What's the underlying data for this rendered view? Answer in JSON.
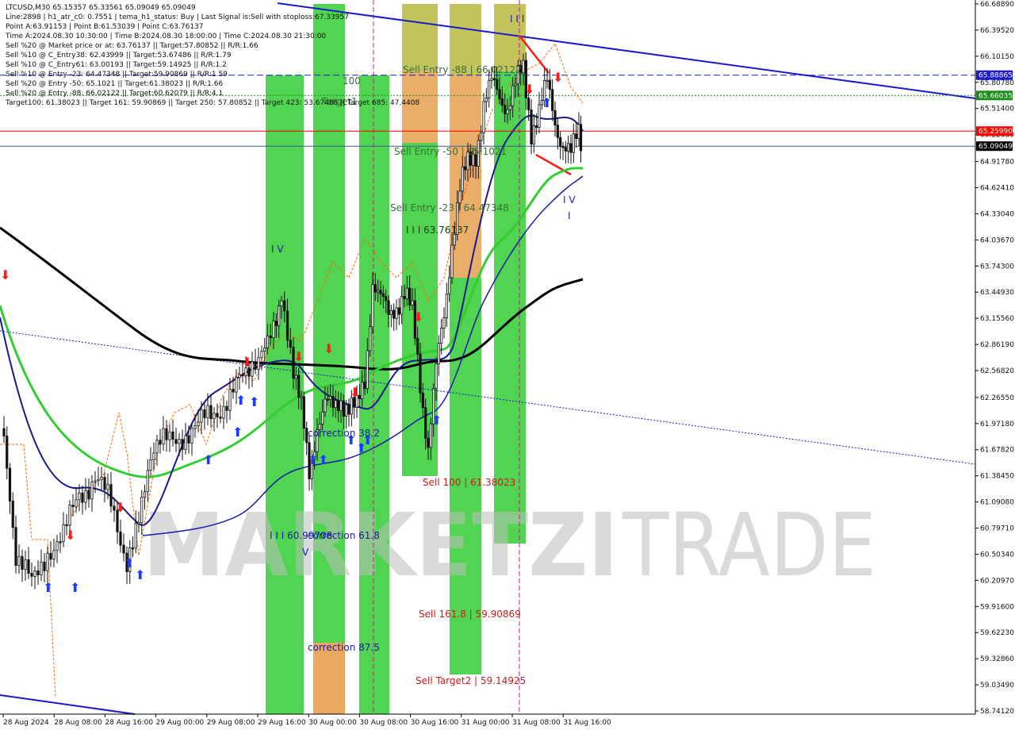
{
  "info": {
    "lines": [
      "LTCUSD,M30  65.15357 65.33561 65.09049 65.09049",
      "Line:2898 | h1_atr_c0: 0.7551 | tema_h1_status: Buy | Last Signal is:Sell with stoploss:67.33957",
      "Point A:63.91153 | Point B:61.53039 | Point C:63.76137",
      "Time A:2024.08.30 10:30:00 | Time B:2024.08.30 18:00:00 | Time C:2024.08.30 21:30:00",
      "Sell %20 @ Market price or at: 63.76137 || Target:57.80852 || R/R:1.66",
      "Sell %10 @ C_Entry38: 62.43999 || Target:53.67486 || R/R:1.79",
      "Sell %10 @ C_Entry61: 63.00193 || Target:59.14925 || R/R:1.2",
      "Sell %10 @ Entry -23: 64.47348 || Target:59.90869 || R/R:1.59",
      "Sell %20 @ Entry -50: 65.1021 || Target:61.38023 || R/R:1.66",
      "Sell %20 @ Entry -88: 66.02122 || Target:60.62079 || R/R:4.1",
      "Target100: 61.38023 || Target 161: 59.90869 || Target 250: 57.80852 || Target 423: 53.67486 || Target 685: 47.4408"
    ]
  },
  "watermark": {
    "left": "MARKETZI",
    "right": "TRADE"
  },
  "colors": {
    "candle": "#111111",
    "bullish_signal": "#1a3cff",
    "bearish_signal": "#ff1a1a",
    "ma_black": "#000000",
    "ma_navy": "#1a1a8c",
    "ma_green": "#33cc33",
    "ma_blue": "#1a1aaa",
    "zone_green": "#33cc33",
    "zone_orange": "#e8a050",
    "zone_olive": "#a0b830",
    "trendline": "#1a1acc",
    "price_current": "#3c5a8c",
    "level_red": "#ff0000"
  },
  "chart_data": {
    "type": "candlestick",
    "symbol": "LTCUSD",
    "timeframe": "M30",
    "ohlc_last": {
      "open": 65.15357,
      "high": 65.33561,
      "low": 65.09049,
      "close": 65.09049
    },
    "ylim": [
      58.7412,
      66.6889
    ],
    "y_ticks": [
      "66.68890",
      "66.39520",
      "66.10150",
      "65.80780",
      "65.51400",
      "65.22030",
      "64.91780",
      "64.62410",
      "64.33040",
      "64.03670",
      "63.74300",
      "63.44930",
      "63.15560",
      "62.86190",
      "62.56820",
      "62.26550",
      "61.97180",
      "61.67820",
      "61.38450",
      "61.09080",
      "60.79710",
      "60.50340",
      "60.20970",
      "59.91600",
      "59.62230",
      "59.32860",
      "59.03490",
      "58.74120"
    ],
    "x_ticks": [
      "28 Aug 2024",
      "28 Aug 08:00",
      "28 Aug 16:00",
      "29 Aug 00:00",
      "29 Aug 08:00",
      "29 Aug 16:00",
      "30 Aug 00:00",
      "30 Aug 08:00",
      "30 Aug 16:00",
      "31 Aug 00:00",
      "31 Aug 08:00",
      "31 Aug 16:00"
    ],
    "price_tags": [
      {
        "value": 65.88865,
        "label": "65.88865",
        "color": "#1a1acc"
      },
      {
        "value": 65.66035,
        "label": "65.66035",
        "color": "#1a8c1a"
      },
      {
        "value": 65.2599,
        "label": "65.25990",
        "color": "#ff0000"
      },
      {
        "value": 65.09049,
        "label": "65.09049",
        "color": "#000000"
      }
    ],
    "horizontal_lines": [
      {
        "value": 65.88865,
        "style": "dashed",
        "color": "#1a1acc"
      },
      {
        "value": 65.66035,
        "style": "dotted",
        "color": "#1a8c1a"
      },
      {
        "value": 65.2599,
        "style": "solid",
        "color": "#ff0000"
      },
      {
        "value": 65.09049,
        "style": "solid",
        "color": "#3c5a8c"
      }
    ],
    "annotations": [
      {
        "text": "Sell Entry -88 | 66.02122",
        "color": "#3c6e3c"
      },
      {
        "text": "Sell Entry -50 | 65.1021",
        "color": "#3c6e3c"
      },
      {
        "text": "Sell Entry -23 | 64.47348",
        "color": "#3c6e3c"
      },
      {
        "text": "I I I 63.76137",
        "color": "#1a3c1a"
      },
      {
        "text": "Sell 100 | 61.38023",
        "color": "#cc1a1a"
      },
      {
        "text": "Sell 161.8 | 59.90869",
        "color": "#cc1a1a"
      },
      {
        "text": "Sell Target2 | 59.14925",
        "color": "#cc1a1a"
      },
      {
        "text": "correction 38.2",
        "color": "#1a1aaa"
      },
      {
        "text": "correction 61.8",
        "color": "#1a1aaa"
      },
      {
        "text": "correction 87.5",
        "color": "#1a1aaa"
      },
      {
        "text": "I I I 60.99708",
        "color": "#1a1aaa"
      },
      {
        "text": "Target1",
        "color": "#3c6e3c"
      },
      {
        "text": "100",
        "color": "#3c6e3c"
      },
      {
        "text": "I V",
        "color": "#1a1aaa"
      },
      {
        "text": "V",
        "color": "#1a1aaa"
      },
      {
        "text": "I I I",
        "color": "#1a1aaa"
      },
      {
        "text": "I V",
        "color": "#1a1aaa"
      },
      {
        "text": "I",
        "color": "#1a1aaa"
      }
    ],
    "grid": false
  }
}
